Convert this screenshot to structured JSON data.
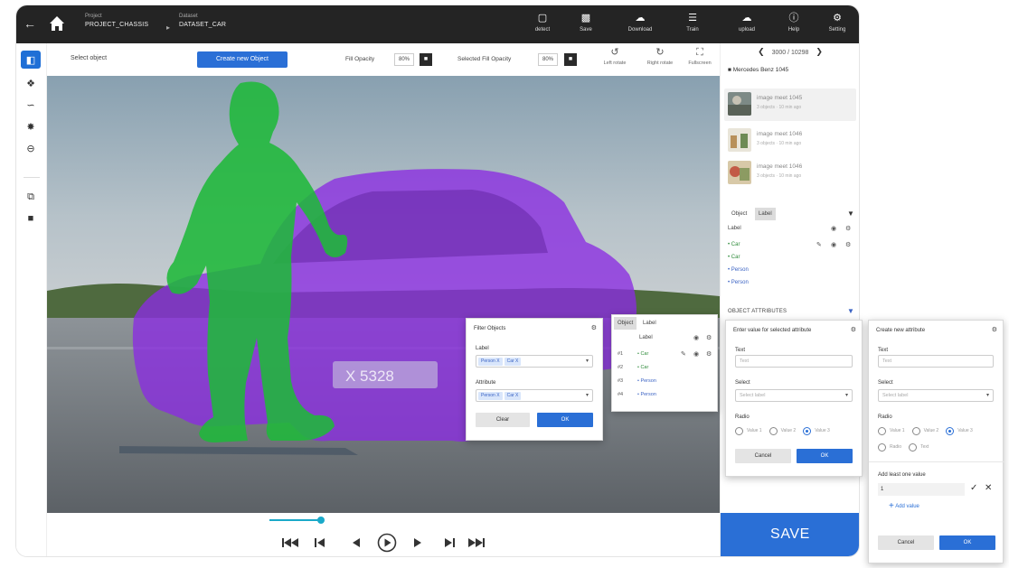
{
  "topbar": {
    "project_label": "Project",
    "project_name": "PROJECT_CHASSIS",
    "dataset_label": "Dataset",
    "dataset_name": "DATASET_CAR",
    "tools": [
      {
        "icon": "detect-icon",
        "label": "detect"
      },
      {
        "icon": "save-icon",
        "label": "Save"
      },
      {
        "icon": "cloud-download-icon",
        "label": "Download"
      },
      {
        "icon": "train-icon",
        "label": "Train"
      },
      {
        "icon": "cloud-upload-icon",
        "label": "upload"
      },
      {
        "icon": "info-icon",
        "label": "Help"
      },
      {
        "icon": "gear-icon",
        "label": "Setting"
      }
    ]
  },
  "options": {
    "select_object": "Select object",
    "create_button": "Create new Object",
    "fill_opacity_label": "Fill Opacity",
    "fill_opacity_value": "80%",
    "selected_fill_label": "Selected Fill Opacity",
    "selected_fill_value": "80%",
    "left_rotate": "Left rotate",
    "right_rotate": "Right rotate",
    "fullscreen": "Fullscreen"
  },
  "canvas": {
    "plate_text": "X 5328",
    "colors": {
      "car_mask": "#8a2be2",
      "person_mask": "#1fb83a"
    }
  },
  "playback": {
    "scrub_fraction": 0.95,
    "buttons": [
      "skip-start-icon",
      "step-back-icon",
      "prev-icon",
      "play-icon",
      "next-icon",
      "step-forward-icon",
      "skip-end-icon"
    ]
  },
  "right_panel": {
    "pager_text": "3000 / 10298",
    "video_title": "Mercedes Benz 1045",
    "images": [
      {
        "name": "image meet 1045",
        "meta": "3 objects · 10 min ago"
      },
      {
        "name": "image meet 1046",
        "meta": "3 objects · 10 min ago"
      },
      {
        "name": "image meet 1046",
        "meta": "3 objects · 10 min ago"
      }
    ],
    "tabs": [
      "Object",
      "Label"
    ],
    "list_header": "Label",
    "list_items": [
      {
        "text": "• Car",
        "kind": "green"
      },
      {
        "text": "• Car",
        "kind": "green"
      },
      {
        "text": "• Person",
        "kind": "blue"
      },
      {
        "text": "• Person",
        "kind": "blue"
      }
    ],
    "attributes_header": "OBJECT ATTRIBUTES",
    "save_label": "SAVE"
  },
  "filter_card": {
    "title": "Filter Objects",
    "label_field": "Label",
    "label_chips": [
      "Person X",
      "Car X"
    ],
    "attribute_field": "Attribute",
    "attribute_chips": [
      "Person X",
      "Car X"
    ],
    "clear": "Clear",
    "ok": "OK"
  },
  "label_card": {
    "tabs": [
      "Object",
      "Label"
    ],
    "header": "Label",
    "rows": [
      {
        "num": "#1",
        "text": "• Car",
        "kind": "green"
      },
      {
        "num": "#2",
        "text": "• Car",
        "kind": "green"
      },
      {
        "num": "#3",
        "text": "• Person",
        "kind": "blue"
      },
      {
        "num": "#4",
        "text": "• Person",
        "kind": "blue"
      }
    ]
  },
  "enter_value_card": {
    "title": "Enter value for selected attribute",
    "text_label": "Text",
    "text_placeholder": "Text",
    "select_label": "Select",
    "select_placeholder": "Select label",
    "radio_label": "Radio",
    "radio_options": [
      "Value 1",
      "Value 2",
      "Value 3"
    ],
    "radio_selected": 2,
    "cancel": "Cancel",
    "ok": "OK"
  },
  "create_attr_card": {
    "title": "Create new attribute",
    "text_label": "Text",
    "text_placeholder": "Text",
    "select_label": "Select",
    "select_placeholder": "Select label",
    "radio_label": "Radio",
    "radio_options_row1": [
      "Value 1",
      "Value 2",
      "Value 3"
    ],
    "radio_options_row2": [
      "Radio",
      "Text"
    ],
    "radio_selected": 2,
    "add_value_label": "Add least one value",
    "value_input": "1",
    "add_value_link": "Add value",
    "cancel": "Cancel",
    "ok": "OK"
  }
}
